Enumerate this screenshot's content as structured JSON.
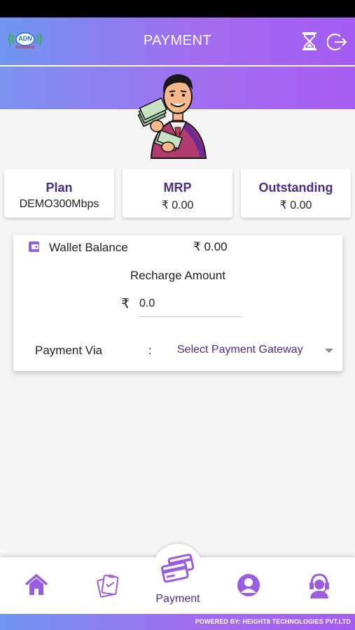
{
  "header": {
    "title": "PAYMENT",
    "logo_text": "ADN",
    "logo_subtext": "Broadband",
    "history_icon": "hourglass-icon",
    "logout_icon": "logout-icon"
  },
  "summary_cards": [
    {
      "title": "Plan",
      "value": "DEMO300Mbps"
    },
    {
      "title": "MRP",
      "value": "₹ 0.00"
    },
    {
      "title": "Outstanding",
      "value": "₹ 0.00"
    }
  ],
  "wallet": {
    "icon": "wallet-icon",
    "label": "Wallet Balance",
    "amount": "₹ 0.00"
  },
  "recharge": {
    "label": "Recharge Amount",
    "currency_symbol": "₹",
    "value": "0.0"
  },
  "payment_via": {
    "label": "Payment Via",
    "separator": ":",
    "selected": "Select Payment Gateway"
  },
  "bottom_nav": {
    "items": [
      {
        "icon": "home-icon",
        "label": ""
      },
      {
        "icon": "clipboard-icon",
        "label": ""
      },
      {
        "icon": "payment-cards-icon",
        "label": "Payment",
        "active": true
      },
      {
        "icon": "profile-icon",
        "label": ""
      },
      {
        "icon": "support-headset-icon",
        "label": ""
      }
    ]
  },
  "footer": {
    "text": "POWERED BY: HEIGHT8 TECHNOLOGIES PVT.LTD"
  },
  "colors": {
    "brand_purple": "#a36cf0",
    "brand_blue": "#6f96f0",
    "accent_dark": "#4b2c8a",
    "icon_purple": "#9a5ce0"
  }
}
